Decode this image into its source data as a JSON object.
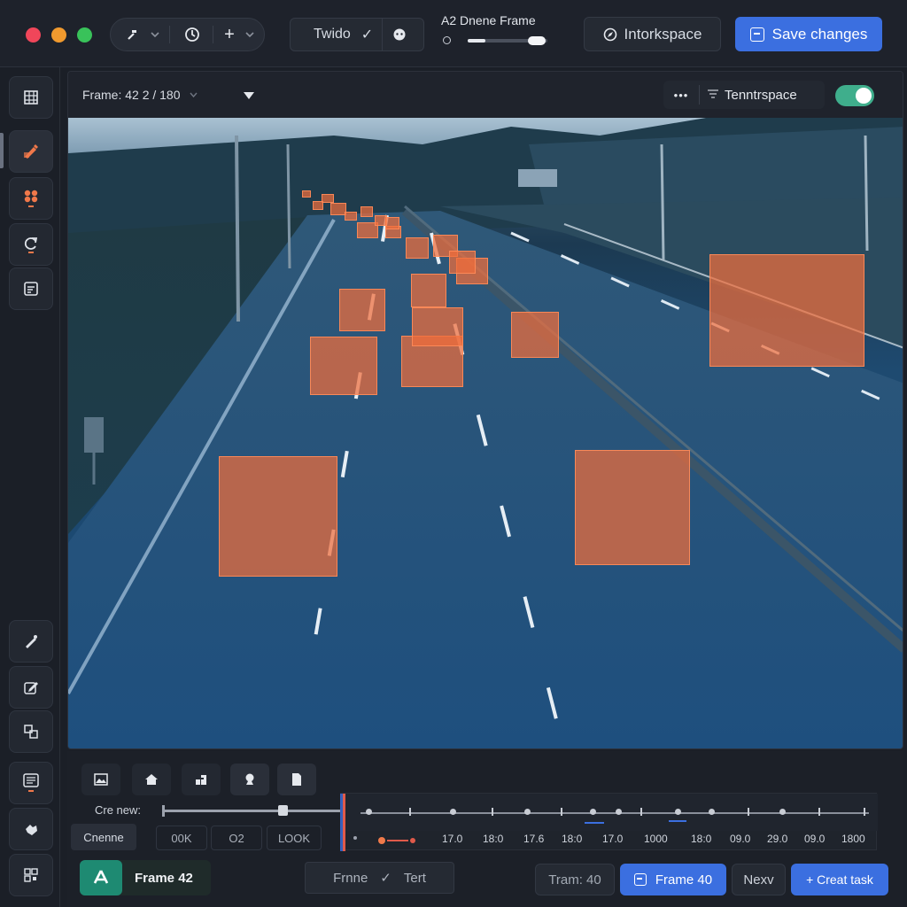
{
  "titlebar": {
    "tool_group": {
      "plus": "+"
    },
    "tool_box": {
      "label": "Twido",
      "check": "✓"
    },
    "frame_info": {
      "title": "A2  Dnene Frame"
    },
    "workspace_button": "Intorkspace",
    "save_button": "Save changes"
  },
  "canvas": {
    "frame_label": "Frame: 42 2 / 180",
    "more": "•••",
    "workspace_label": "Tenntrspace",
    "toggle_on": true
  },
  "timeline": {
    "create_new": "Cre new:",
    "rename": "Cnenne",
    "field1": "00K",
    "field2": "O2",
    "field3": "LOOK",
    "progress": 0.9,
    "labels": [
      "17.0",
      "18:0",
      "17.6",
      "18:0",
      "17.0",
      "1000",
      "18:0",
      "09.0",
      "29.0",
      "09.0",
      "1800"
    ]
  },
  "footer": {
    "app_label": "Frame 42",
    "middle_left": "Frnne",
    "middle_check": "✓",
    "middle_right": "Tert",
    "tram_label": "Tram: 40",
    "frame_button": "Frame 40",
    "next_button": "Nexv",
    "create_button": "+ Creat task"
  },
  "colors": {
    "accent": "#3b6fe0",
    "bbox": "#f06e3c",
    "toggle": "#3fae8c"
  }
}
